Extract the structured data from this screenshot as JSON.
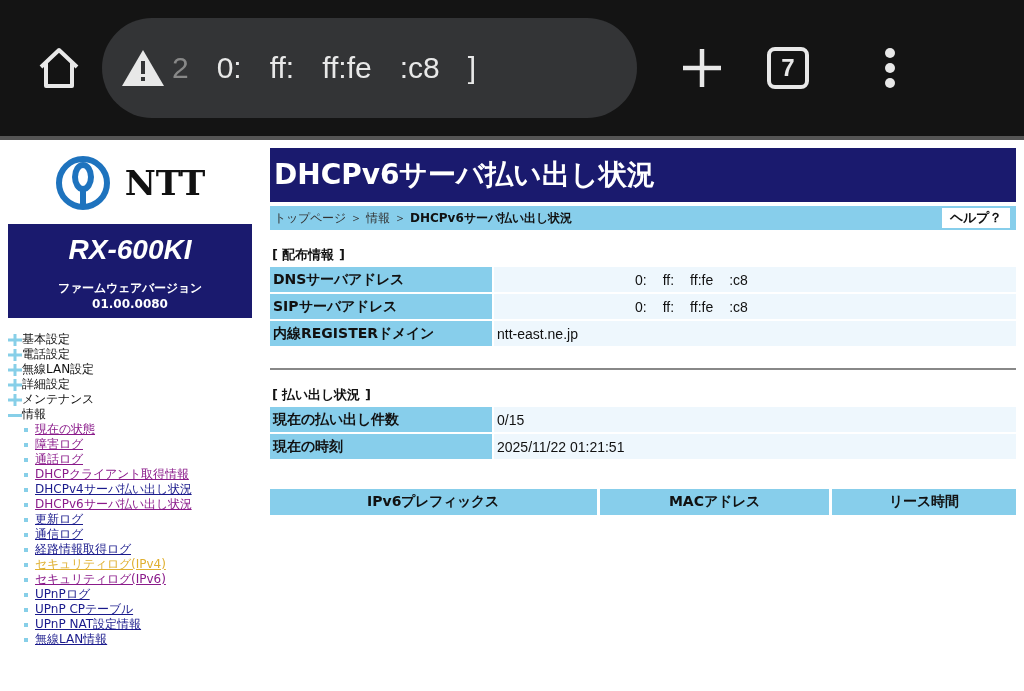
{
  "browser": {
    "url_fragments": [
      "2",
      "0:",
      "ff:",
      "ff:fe",
      ":c8",
      "]"
    ],
    "tab_count": "7"
  },
  "sidebar": {
    "logo_text": "NTT",
    "model": "RX-600KI",
    "firmware_label": "ファームウェアバージョン",
    "firmware_version": "01.00.0080",
    "menu": [
      {
        "label": "基本設定",
        "expanded": false
      },
      {
        "label": "電話設定",
        "expanded": false
      },
      {
        "label": "無線LAN設定",
        "expanded": false
      },
      {
        "label": "詳細設定",
        "expanded": false
      },
      {
        "label": "メンテナンス",
        "expanded": false
      },
      {
        "label": "情報",
        "expanded": true,
        "children": [
          {
            "label": "現在の状態",
            "kind": "visited"
          },
          {
            "label": "障害ログ",
            "kind": "visited"
          },
          {
            "label": "通話ログ",
            "kind": "visited"
          },
          {
            "label": "DHCPクライアント取得情報",
            "kind": "visited"
          },
          {
            "label": "DHCPv4サーバ払い出し状況",
            "kind": "link"
          },
          {
            "label": "DHCPv6サーバ払い出し状況",
            "kind": "visited"
          },
          {
            "label": "更新ログ",
            "kind": "link"
          },
          {
            "label": "通信ログ",
            "kind": "link"
          },
          {
            "label": "経路情報取得ログ",
            "kind": "link"
          },
          {
            "label": "セキュリティログ(IPv4)",
            "kind": "active"
          },
          {
            "label": "セキュリティログ(IPv6)",
            "kind": "visited"
          },
          {
            "label": "UPnPログ",
            "kind": "link"
          },
          {
            "label": "UPnP CPテーブル",
            "kind": "link"
          },
          {
            "label": "UPnP NAT設定情報",
            "kind": "link"
          },
          {
            "label": "無線LAN情報",
            "kind": "link"
          }
        ]
      }
    ]
  },
  "page": {
    "title": "DHCPv6サーバ払い出し状況",
    "breadcrumb": [
      "トップページ",
      "＞",
      "情報",
      "＞",
      "DHCPv6サーバ払い出し状況"
    ],
    "help": "ヘルプ？",
    "sections": [
      {
        "heading": "[ 配布情報 ]",
        "rows": [
          {
            "label": "DNSサーバアドレス",
            "value_fragments": [
              "0:",
              "ff:",
              "ff:fe",
              ":c8"
            ]
          },
          {
            "label": "SIPサーバアドレス",
            "value_fragments": [
              "0:",
              "ff:",
              "ff:fe",
              ":c8"
            ]
          },
          {
            "label": "内線REGISTERドメイン",
            "value_fragments": [
              "ntt-east.ne.jp"
            ]
          }
        ]
      },
      {
        "heading": "[ 払い出し状況 ]",
        "rows": [
          {
            "label": "現在の払い出し件数",
            "value_fragments": [
              "0/15"
            ]
          },
          {
            "label": "現在の時刻",
            "value_fragments": [
              "2025/11/22 01:21:51"
            ]
          }
        ]
      }
    ],
    "table": {
      "columns": [
        "IPv6プレフィックス",
        "MACアドレス",
        "リース時間"
      ]
    }
  }
}
